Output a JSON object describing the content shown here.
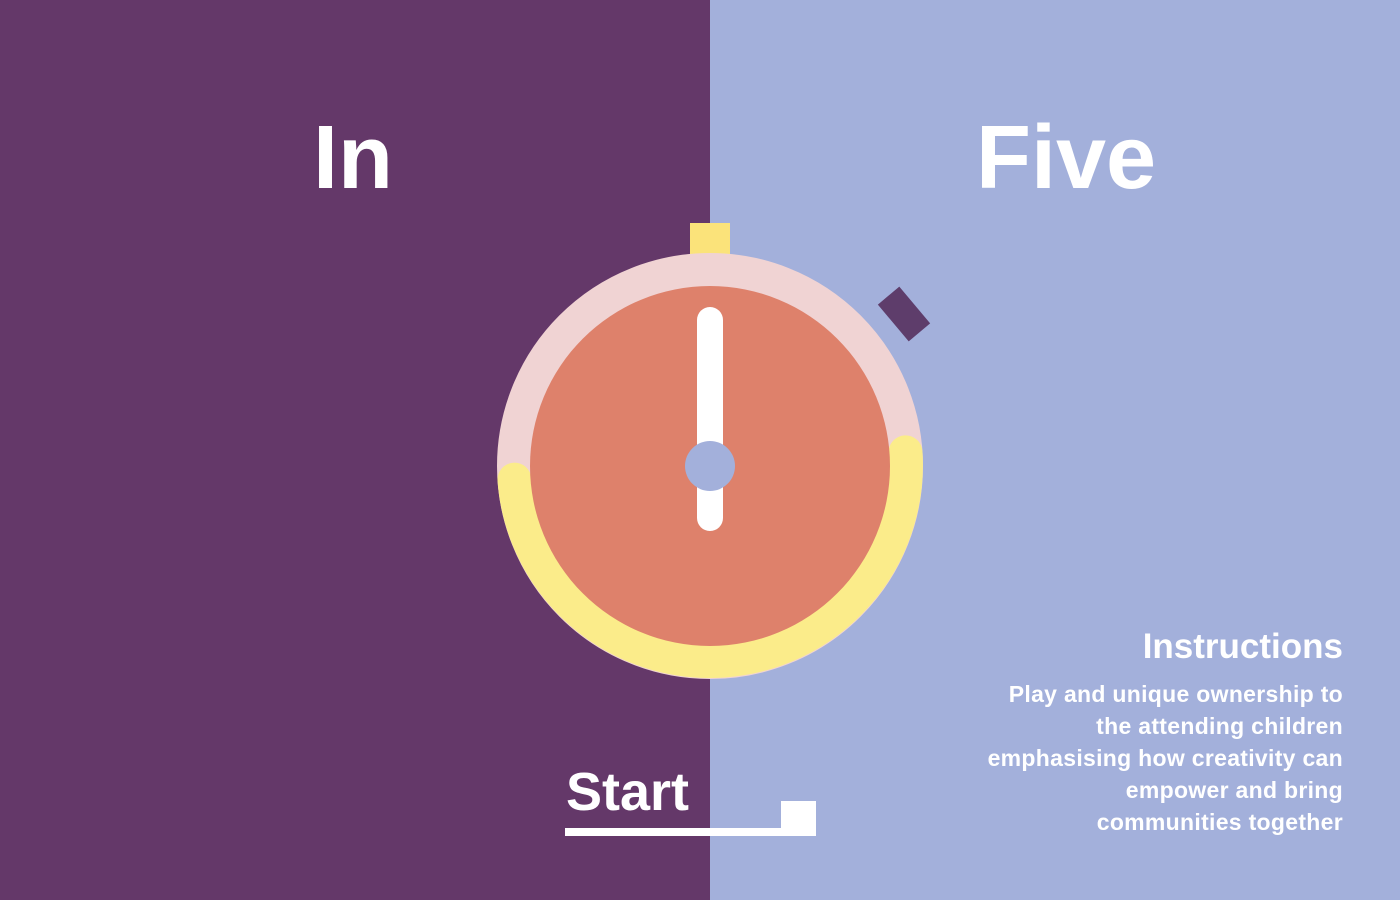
{
  "colors": {
    "left_panel": "#643869",
    "right_panel": "#a3b0db",
    "dial_face": "#de816b",
    "dial_ring_top": "#f0d3d3",
    "dial_ring_bottom": "#fbec8a",
    "crown": "#fbe37a",
    "side_button": "#5e3d6b",
    "hand": "#ffffff",
    "hub": "#a3b0db",
    "text": "#ffffff"
  },
  "title": {
    "left_word": "In",
    "right_word": "Five"
  },
  "timer": {
    "progress": 0.5,
    "crown_icon": "stopwatch-crown-icon",
    "side_button_icon": "stopwatch-side-button-icon"
  },
  "start": {
    "label": "Start"
  },
  "instructions": {
    "title": "Instructions",
    "lines": [
      "Play and unique ownership to",
      "the attending children",
      "emphasising how creativity can",
      "empower and bring",
      "communities together"
    ]
  }
}
